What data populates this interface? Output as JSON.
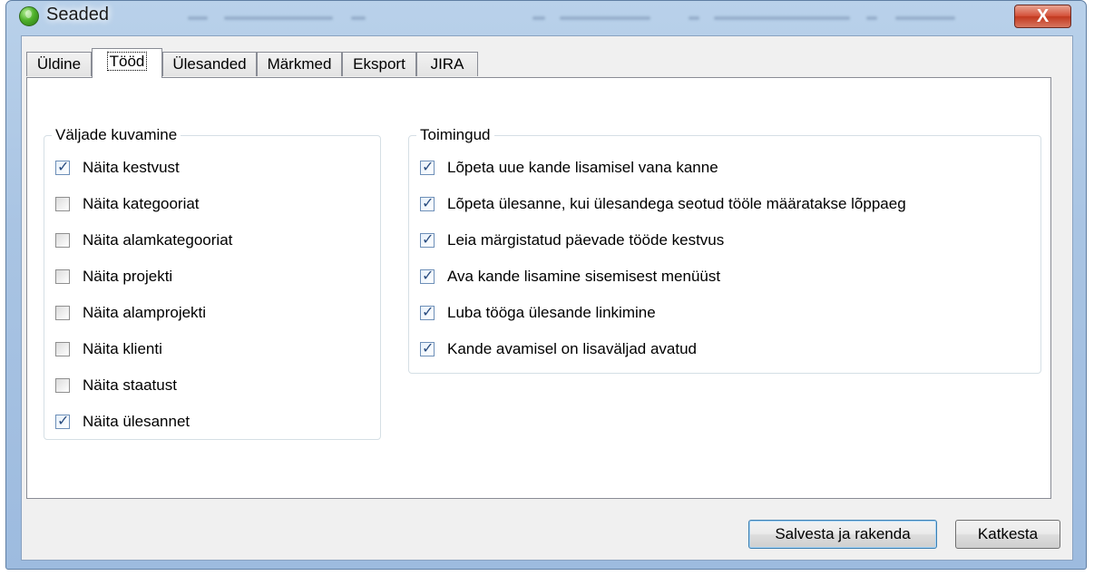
{
  "window": {
    "title": "Seaded",
    "close_symbol": "X"
  },
  "tabs": [
    "Üldine",
    "Tööd",
    "Ülesanded",
    "Märkmed",
    "Eksport",
    "JIRA"
  ],
  "active_tab": 1,
  "display_group": {
    "title": "Väljade kuvamine",
    "items": [
      {
        "label": "Näita kestvust",
        "checked": true
      },
      {
        "label": "Näita kategooriat",
        "checked": false
      },
      {
        "label": "Näita alamkategooriat",
        "checked": false
      },
      {
        "label": "Näita projekti",
        "checked": false
      },
      {
        "label": "Näita alamprojekti",
        "checked": false
      },
      {
        "label": "Näita klienti",
        "checked": false
      },
      {
        "label": "Näita staatust",
        "checked": false
      },
      {
        "label": "Näita ülesannet",
        "checked": true
      }
    ]
  },
  "actions_group": {
    "title": "Toimingud",
    "items": [
      {
        "label": "Lõpeta uue kande lisamisel vana kanne",
        "checked": true
      },
      {
        "label": "Lõpeta ülesanne, kui ülesandega seotud tööle määratakse lõppaeg",
        "checked": true
      },
      {
        "label": "Leia märgistatud päevade tööde kestvus",
        "checked": true
      },
      {
        "label": "Ava kande lisamine sisemisest menüüst",
        "checked": true
      },
      {
        "label": "Luba tööga ülesande linkimine",
        "checked": true
      },
      {
        "label": "Kande avamisel on lisaväljad avatud",
        "checked": true
      }
    ]
  },
  "buttons": {
    "save": "Salvesta ja rakenda",
    "cancel": "Katkesta"
  }
}
